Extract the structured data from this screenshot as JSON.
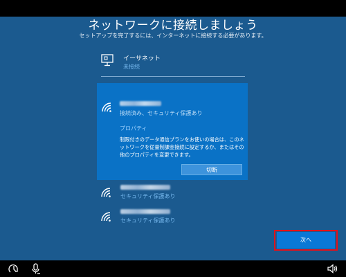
{
  "header": {
    "title": "ネットワークに接続しましょう",
    "subtitle": "セットアップを完了するには、インターネットに接続する必要があります。"
  },
  "ethernet": {
    "icon": "ethernet-monitor-icon",
    "name": "イーサネット",
    "status": "未接続"
  },
  "selected_network": {
    "icon": "wifi-icon",
    "status": "接続済み、セキュリティ保護あり",
    "properties_link": "プロパティ",
    "description": "制限付きのデータ通信プランをお使いの場合は、このネットワークを従量制課金接続に設定するか、またはその他のプロパティを変更できます。",
    "disconnect_label": "切断"
  },
  "networks": [
    {
      "icon": "wifi-icon",
      "status": "セキュリティ保護あり"
    },
    {
      "icon": "wifi-icon",
      "status": "セキュリティ保護あり"
    }
  ],
  "footer": {
    "next_label": "次へ",
    "icons": [
      "ease-of-access-icon",
      "microphone-icon",
      "volume-icon"
    ]
  },
  "colors": {
    "background": "#1b5a8f",
    "selected_card": "#0a72c6",
    "accent_text": "#74b6ec",
    "next_button": "#0a78d6",
    "highlight_outline": "#e3101a"
  }
}
